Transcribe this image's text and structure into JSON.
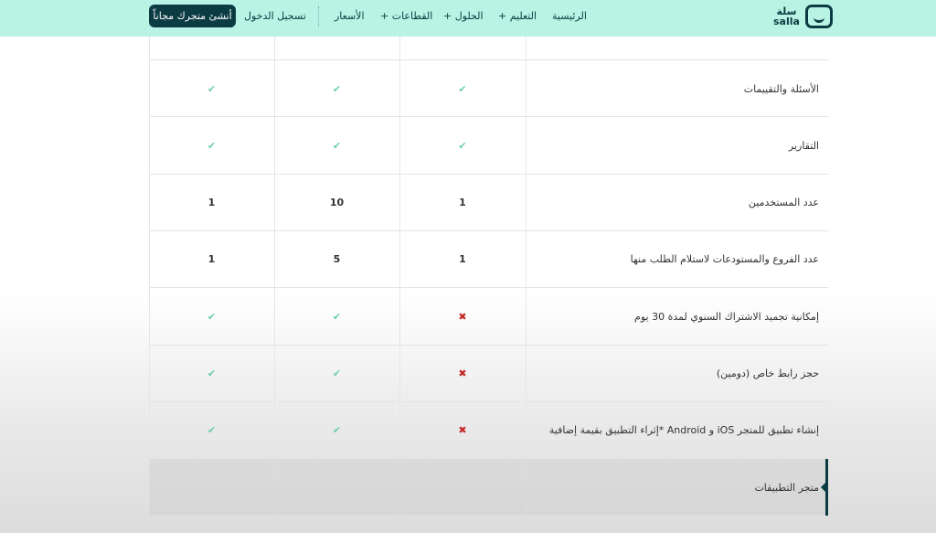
{
  "header": {
    "logo_ar": "سلة",
    "logo_en": "salla",
    "nav": [
      {
        "label": "الرئيسية"
      },
      {
        "label": "التعليم +"
      },
      {
        "label": "الحلول +"
      },
      {
        "label": "القطاعات +"
      },
      {
        "label": "الأسعار"
      }
    ],
    "login": "تسجيل الدخول",
    "cta": "أنشئ متجرك مجاناً"
  },
  "rows": [
    {
      "label": "الأسئلة والتقييمات",
      "values": [
        "check",
        "check",
        "check"
      ]
    },
    {
      "label": "التقارير",
      "values": [
        "check",
        "check",
        "check"
      ]
    },
    {
      "label": "عدد المستخدمين",
      "values": [
        "1",
        "10",
        "1"
      ]
    },
    {
      "label": "عدد الفروع والمستودعات لاستلام الطلب منها",
      "values": [
        "1",
        "5",
        "1"
      ]
    },
    {
      "label": "إمكانية تجميد الاشتراك السنوي لمدة 30 يوم",
      "values": [
        "cross",
        "check",
        "check"
      ]
    },
    {
      "label": "حجز رابط خاص (دومين)",
      "values": [
        "cross",
        "check",
        "check"
      ]
    },
    {
      "label": "إنشاء تطبيق للمتجر iOS و Android *إثراء التطبيق بقيمة إضافية",
      "values": [
        "cross",
        "check",
        "check"
      ]
    }
  ],
  "section": {
    "label": "متجر التطبيقات"
  },
  "icons": {
    "check": "✔",
    "cross": "✖"
  }
}
